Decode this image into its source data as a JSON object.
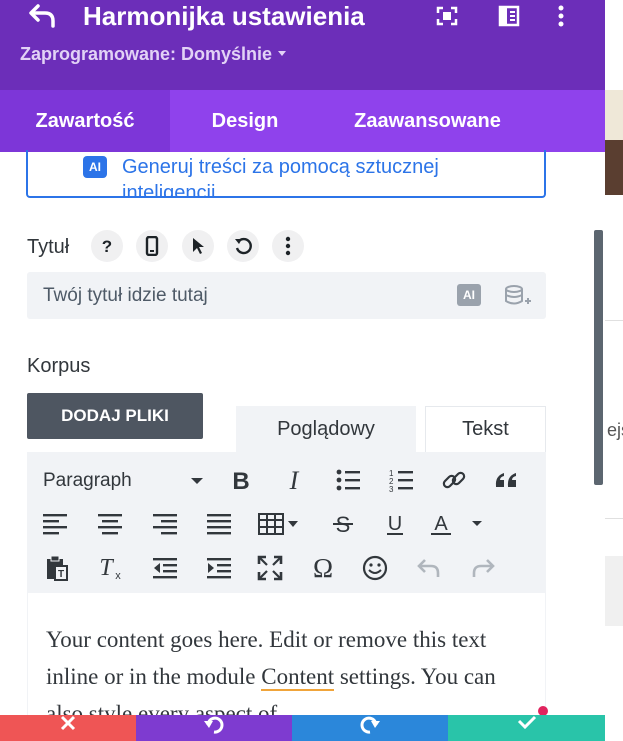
{
  "header": {
    "title": "Harmonijka ustawienia",
    "preset_label": "Zaprogramowane: Domyślnie",
    "icons": [
      "back-arrow-icon",
      "expand-icon",
      "split-view-icon",
      "more-vertical-icon"
    ]
  },
  "tabs": [
    {
      "label": "Zawartość",
      "active": true
    },
    {
      "label": "Design",
      "active": false
    },
    {
      "label": "Zaawansowane",
      "active": false
    }
  ],
  "ai_generate": {
    "badge": "AI",
    "label": "Generuj treści za pomocą sztucznej inteligencji"
  },
  "title_field": {
    "label": "Tytuł",
    "placeholder": "Twój tytuł idzie tutaj",
    "ai_badge": "AI",
    "label_icons": [
      "help-icon",
      "mobile-icon",
      "pointer-icon",
      "reset-icon",
      "more-icon"
    ]
  },
  "body_field": {
    "label": "Korpus",
    "upload_button": "DODAJ PLIKI",
    "tab_visual": "Poglądowy",
    "tab_text": "Tekst",
    "format_select": "Paragraph",
    "content_before": "Your content goes here. Edit or remove this text inline or in the module ",
    "content_link": "Content",
    "content_after": " settings. You can also style every aspect of"
  },
  "bottom_bar": [
    {
      "name": "discard",
      "color": "#ef5555"
    },
    {
      "name": "undo",
      "color": "#7e3bd0"
    },
    {
      "name": "redo",
      "color": "#2b87da"
    },
    {
      "name": "save",
      "color": "#29c4a9"
    }
  ],
  "background_page": {
    "text_fragment": "ejs"
  },
  "colors": {
    "header": "#6c2eb9",
    "tabs": "#8f42ec",
    "tab_active": "#7d36d8",
    "ai_blue": "#2c74e8",
    "upload_button": "#4e5661"
  }
}
